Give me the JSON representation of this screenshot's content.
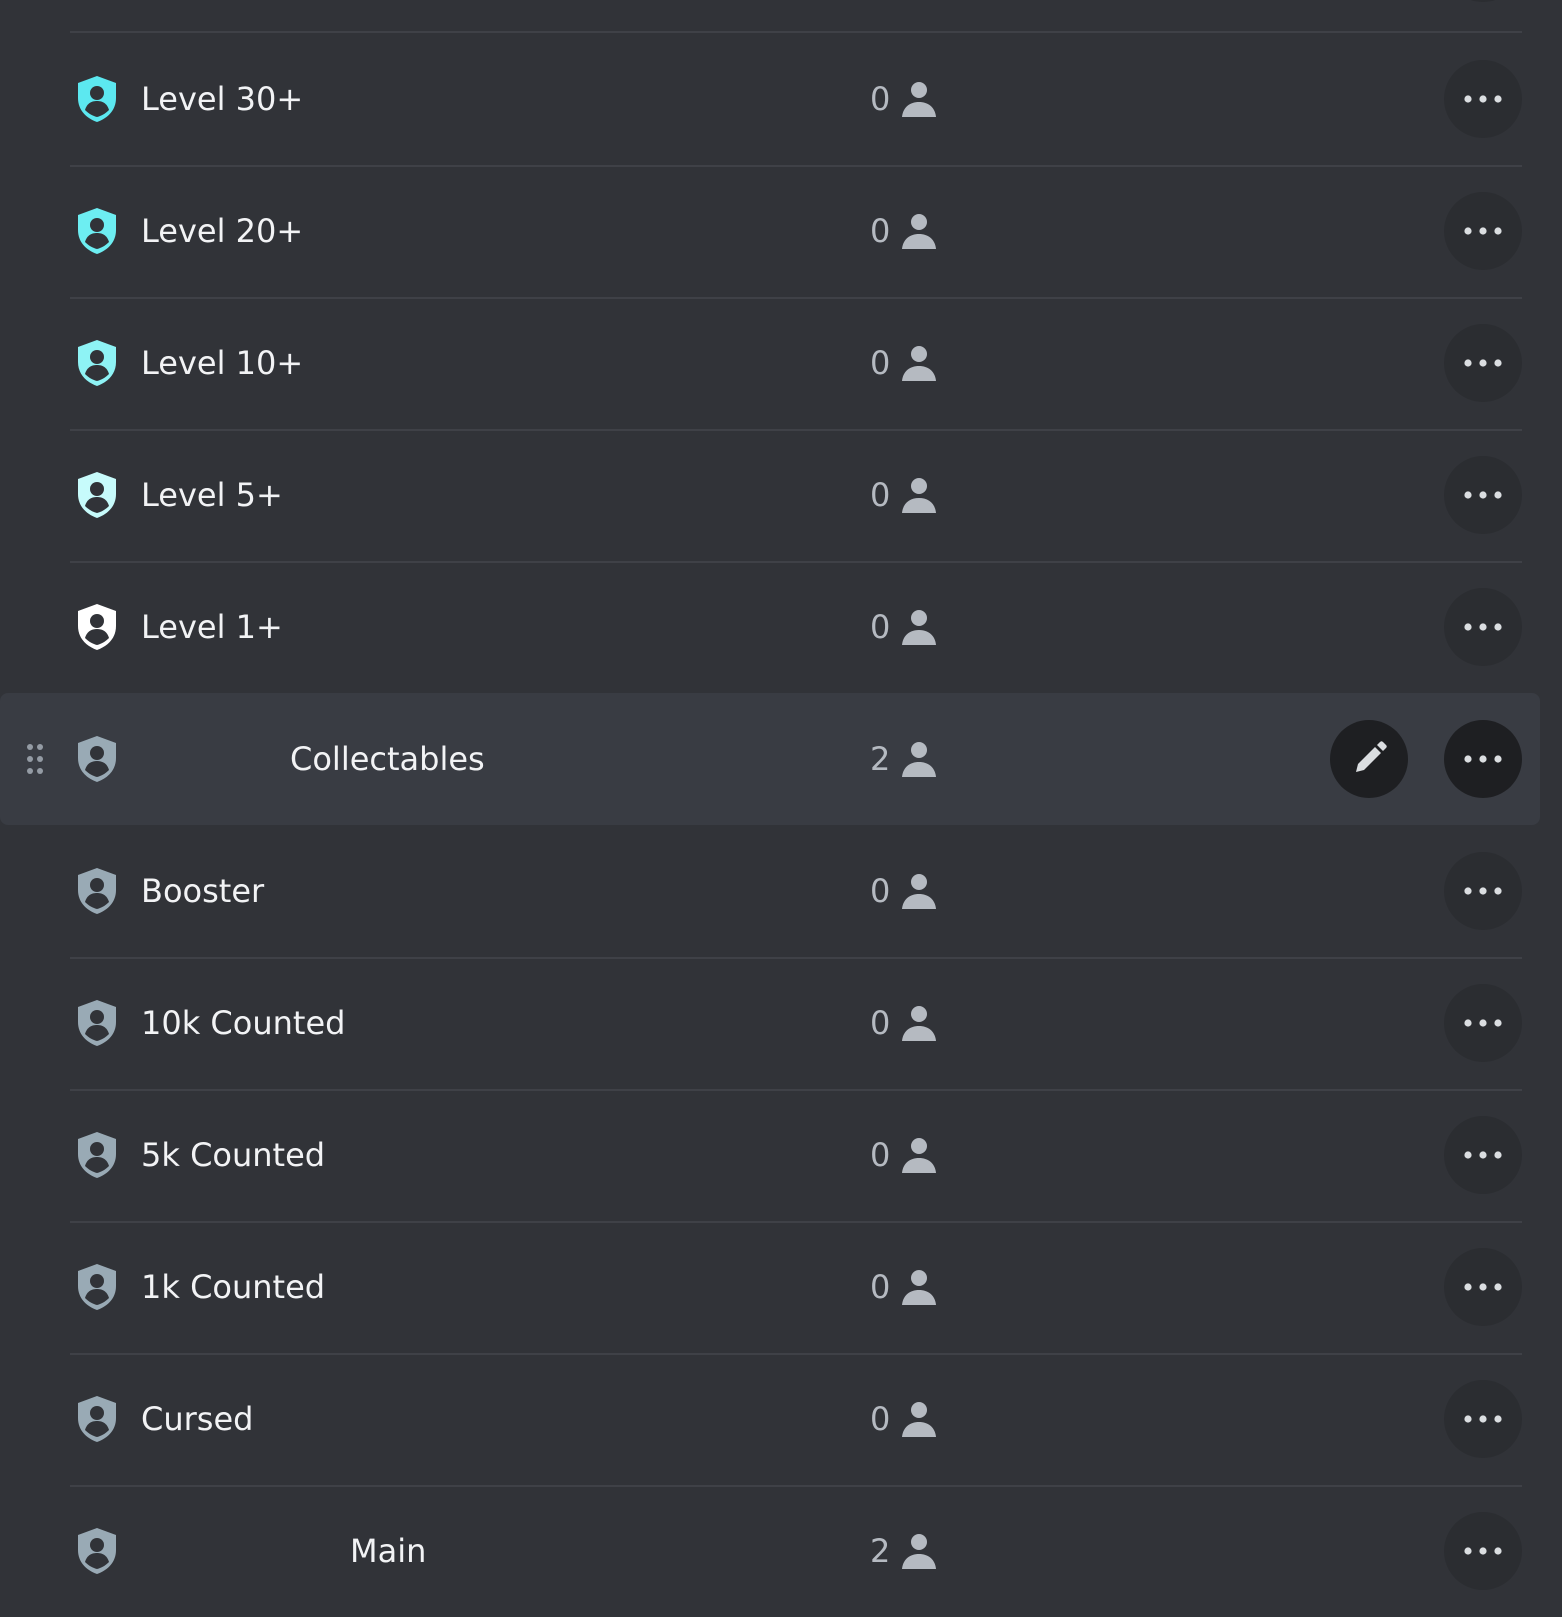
{
  "roles": [
    {
      "name": "Level 30+",
      "count": "0",
      "icon_color": "#5ce8f0",
      "hovered": false
    },
    {
      "name": "Level 20+",
      "count": "0",
      "icon_color": "#6deef2",
      "hovered": false
    },
    {
      "name": "Level 10+",
      "count": "0",
      "icon_color": "#8ef3f5",
      "hovered": false
    },
    {
      "name": "Level 5+",
      "count": "0",
      "icon_color": "#c7fbfb",
      "hovered": false
    },
    {
      "name": "Level 1+",
      "count": "0",
      "icon_color": "#ffffff",
      "hovered": false
    },
    {
      "name": "Collectables",
      "count": "2",
      "icon_color": "#99aab5",
      "hovered": true
    },
    {
      "name": "Booster",
      "count": "0",
      "icon_color": "#99aab5",
      "hovered": false
    },
    {
      "name": "10k Counted",
      "count": "0",
      "icon_color": "#99aab5",
      "hovered": false
    },
    {
      "name": "5k Counted",
      "count": "0",
      "icon_color": "#99aab5",
      "hovered": false
    },
    {
      "name": "1k Counted",
      "count": "0",
      "icon_color": "#99aab5",
      "hovered": false
    },
    {
      "name": "Cursed",
      "count": "0",
      "icon_color": "#99aab5",
      "hovered": false
    },
    {
      "name": "Main",
      "count": "2",
      "icon_color": "#99aab5",
      "hovered": false
    }
  ],
  "icons": {
    "role": "shield-person-icon",
    "members": "person-icon",
    "more": "ellipsis-icon",
    "edit": "pencil-icon",
    "drag": "drag-handle-icon"
  },
  "colors": {
    "background": "#313338",
    "hover_row": "#393c43",
    "button": "#2b2d31",
    "button_strong": "#1e1f22",
    "text": "#f2f3f5",
    "muted": "#b5bac1"
  }
}
